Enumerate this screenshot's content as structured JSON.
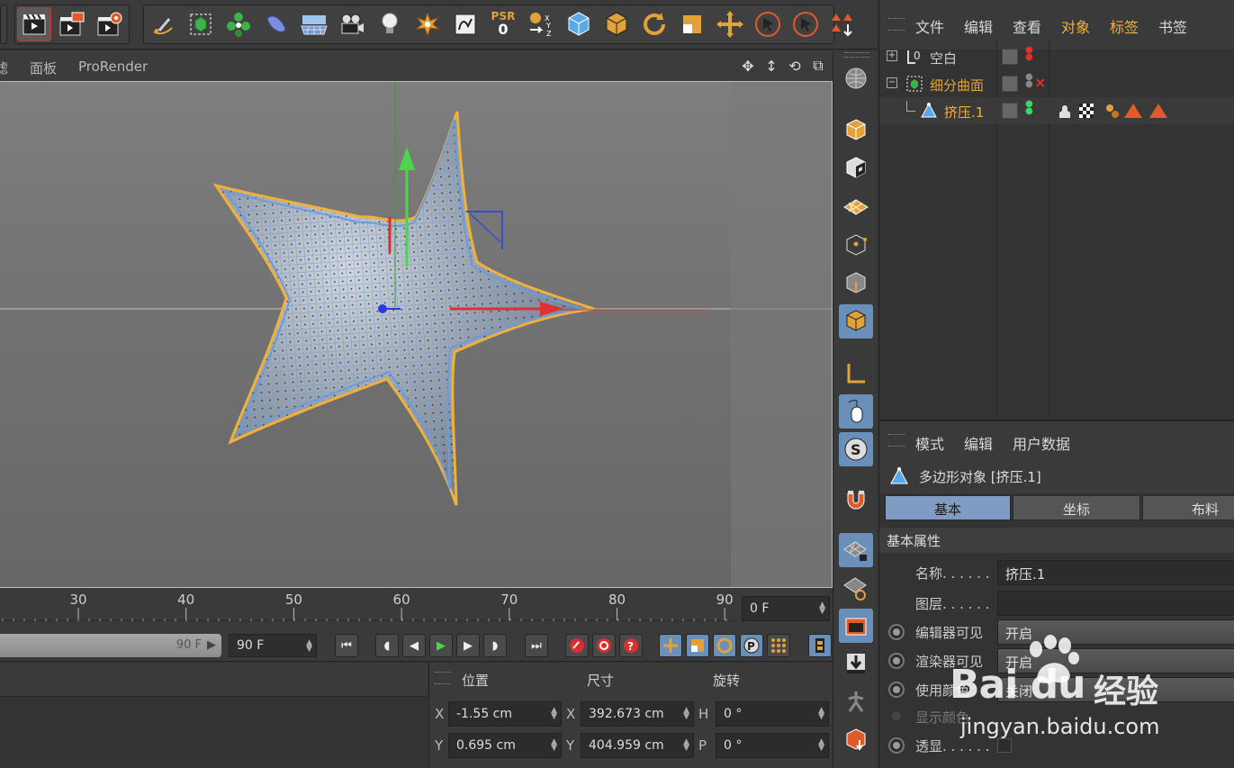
{
  "toolbar": {
    "psr_label": "PSR",
    "psr_value": "0",
    "xyz_label": "X Y Z"
  },
  "viewport_menu": {
    "items": [
      "滤",
      "面板",
      "ProRender"
    ]
  },
  "timeline": {
    "ticks": [
      "30",
      "40",
      "50",
      "60",
      "70",
      "80",
      "90"
    ],
    "current_frame": "0 F",
    "range_end_label": "90 F",
    "end_frame": "90 F"
  },
  "coords": {
    "headers": [
      "位置",
      "尺寸",
      "旋转"
    ],
    "rows": [
      {
        "pos_axis": "X",
        "pos": "-1.55 cm",
        "size_axis": "X",
        "size": "392.673 cm",
        "rot_axis": "H",
        "rot": "0 °"
      },
      {
        "pos_axis": "Y",
        "pos": "0.695 cm",
        "size_axis": "Y",
        "size": "404.959 cm",
        "rot_axis": "P",
        "rot": "0 °"
      }
    ]
  },
  "object_manager": {
    "menu": [
      "文件",
      "编辑",
      "查看",
      "对象",
      "标签",
      "书签"
    ],
    "objects": [
      {
        "name": "空白",
        "color": "#cfcfcf"
      },
      {
        "name": "细分曲面",
        "color": "#e2a23a"
      },
      {
        "name": "挤压.1",
        "color": "#f0b13a"
      }
    ]
  },
  "attribute_manager": {
    "menu": [
      "模式",
      "编辑",
      "用户数据"
    ],
    "title": "多边形对象 [挤压.1]",
    "tabs": [
      "基本",
      "坐标",
      "布料"
    ],
    "section": "基本属性",
    "props": [
      {
        "label": "名称. . . . . .",
        "value": "挤压.1"
      },
      {
        "label": "图层. . . . . .",
        "value": ""
      },
      {
        "label": "编辑器可见",
        "value": "开启"
      },
      {
        "label": "渲染器可见",
        "value": "开启"
      },
      {
        "label": "使用颜色",
        "value": "关闭"
      },
      {
        "label": "显示颜色",
        "value": ""
      },
      {
        "label": "透显. . . . . .",
        "value": ""
      }
    ]
  },
  "watermark": {
    "brand": "Bai du",
    "suffix": "经验",
    "url": "jingyan.baidu.com"
  },
  "colors": {
    "accent": "#f0b13a",
    "active_blue": "#6a8fb8",
    "mesh_blue": "#6f9ad6"
  }
}
